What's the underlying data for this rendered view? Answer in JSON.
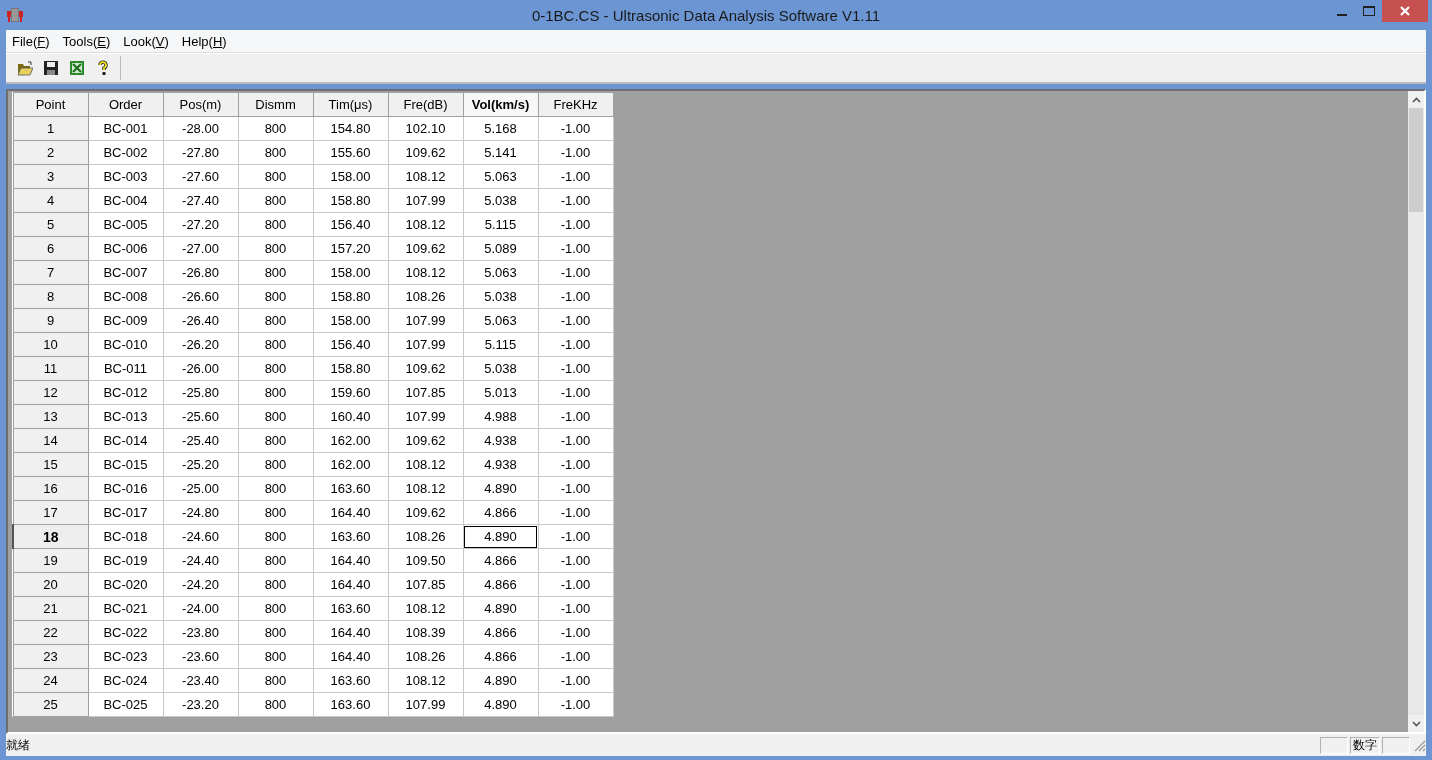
{
  "window": {
    "title": "0-1BC.CS - Ultrasonic Data Analysis Software V1.11"
  },
  "menu": [
    "File(F)",
    "Tools(E)",
    "Look(V)",
    "Help(H)"
  ],
  "toolbar": [
    {
      "kind": "open"
    },
    {
      "kind": "save"
    },
    {
      "kind": "excel"
    },
    {
      "kind": "help"
    }
  ],
  "table": {
    "columns": [
      {
        "label": "Point",
        "selected": false
      },
      {
        "label": "Order",
        "selected": false
      },
      {
        "label": "Pos(m)",
        "selected": false
      },
      {
        "label": "Dismm",
        "selected": false
      },
      {
        "label": "Tim(μs)",
        "selected": false
      },
      {
        "label": "Fre(dB)",
        "selected": false
      },
      {
        "label": "Vol(km/s)",
        "selected": true
      },
      {
        "label": "FreKHz",
        "selected": false
      }
    ],
    "rows": [
      {
        "cells": [
          "1",
          "BC-001",
          "-28.00",
          "800",
          "154.80",
          "102.10",
          "5.168",
          "-1.00"
        ],
        "selected": false
      },
      {
        "cells": [
          "2",
          "BC-002",
          "-27.80",
          "800",
          "155.60",
          "109.62",
          "5.141",
          "-1.00"
        ],
        "selected": false
      },
      {
        "cells": [
          "3",
          "BC-003",
          "-27.60",
          "800",
          "158.00",
          "108.12",
          "5.063",
          "-1.00"
        ],
        "selected": false
      },
      {
        "cells": [
          "4",
          "BC-004",
          "-27.40",
          "800",
          "158.80",
          "107.99",
          "5.038",
          "-1.00"
        ],
        "selected": false
      },
      {
        "cells": [
          "5",
          "BC-005",
          "-27.20",
          "800",
          "156.40",
          "108.12",
          "5.115",
          "-1.00"
        ],
        "selected": false
      },
      {
        "cells": [
          "6",
          "BC-006",
          "-27.00",
          "800",
          "157.20",
          "109.62",
          "5.089",
          "-1.00"
        ],
        "selected": false
      },
      {
        "cells": [
          "7",
          "BC-007",
          "-26.80",
          "800",
          "158.00",
          "108.12",
          "5.063",
          "-1.00"
        ],
        "selected": false
      },
      {
        "cells": [
          "8",
          "BC-008",
          "-26.60",
          "800",
          "158.80",
          "108.26",
          "5.038",
          "-1.00"
        ],
        "selected": false
      },
      {
        "cells": [
          "9",
          "BC-009",
          "-26.40",
          "800",
          "158.00",
          "107.99",
          "5.063",
          "-1.00"
        ],
        "selected": false
      },
      {
        "cells": [
          "10",
          "BC-010",
          "-26.20",
          "800",
          "156.40",
          "107.99",
          "5.115",
          "-1.00"
        ],
        "selected": false
      },
      {
        "cells": [
          "11",
          "BC-011",
          "-26.00",
          "800",
          "158.80",
          "109.62",
          "5.038",
          "-1.00"
        ],
        "selected": false
      },
      {
        "cells": [
          "12",
          "BC-012",
          "-25.80",
          "800",
          "159.60",
          "107.85",
          "5.013",
          "-1.00"
        ],
        "selected": false
      },
      {
        "cells": [
          "13",
          "BC-013",
          "-25.60",
          "800",
          "160.40",
          "107.99",
          "4.988",
          "-1.00"
        ],
        "selected": false
      },
      {
        "cells": [
          "14",
          "BC-014",
          "-25.40",
          "800",
          "162.00",
          "109.62",
          "4.938",
          "-1.00"
        ],
        "selected": false
      },
      {
        "cells": [
          "15",
          "BC-015",
          "-25.20",
          "800",
          "162.00",
          "108.12",
          "4.938",
          "-1.00"
        ],
        "selected": false
      },
      {
        "cells": [
          "16",
          "BC-016",
          "-25.00",
          "800",
          "163.60",
          "108.12",
          "4.890",
          "-1.00"
        ],
        "selected": false
      },
      {
        "cells": [
          "17",
          "BC-017",
          "-24.80",
          "800",
          "164.40",
          "109.62",
          "4.866",
          "-1.00"
        ],
        "selected": false
      },
      {
        "cells": [
          "18",
          "BC-018",
          "-24.60",
          "800",
          "163.60",
          "108.26",
          "4.890",
          "-1.00"
        ],
        "selected": true
      },
      {
        "cells": [
          "19",
          "BC-019",
          "-24.40",
          "800",
          "164.40",
          "109.50",
          "4.866",
          "-1.00"
        ],
        "selected": false
      },
      {
        "cells": [
          "20",
          "BC-020",
          "-24.20",
          "800",
          "164.40",
          "107.85",
          "4.866",
          "-1.00"
        ],
        "selected": false
      },
      {
        "cells": [
          "21",
          "BC-021",
          "-24.00",
          "800",
          "163.60",
          "108.12",
          "4.890",
          "-1.00"
        ],
        "selected": false
      },
      {
        "cells": [
          "22",
          "BC-022",
          "-23.80",
          "800",
          "164.40",
          "108.39",
          "4.866",
          "-1.00"
        ],
        "selected": false
      },
      {
        "cells": [
          "23",
          "BC-023",
          "-23.60",
          "800",
          "164.40",
          "108.26",
          "4.866",
          "-1.00"
        ],
        "selected": false
      },
      {
        "cells": [
          "24",
          "BC-024",
          "-23.40",
          "800",
          "163.60",
          "108.12",
          "4.890",
          "-1.00"
        ],
        "selected": false
      },
      {
        "cells": [
          "25",
          "BC-025",
          "-23.20",
          "800",
          "163.60",
          "107.99",
          "4.890",
          "-1.00"
        ],
        "selected": false
      }
    ]
  },
  "status_bar": {
    "message": "就绪",
    "indicators": [
      "数字"
    ]
  }
}
